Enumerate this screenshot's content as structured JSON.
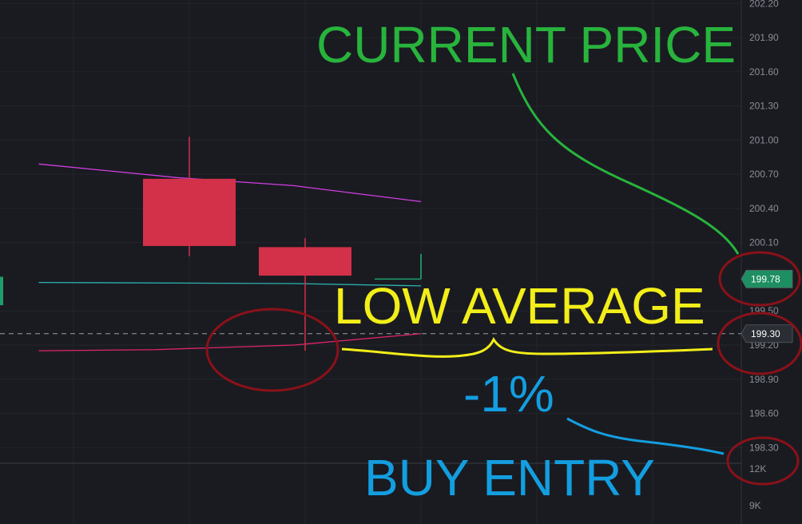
{
  "chart_data": {
    "type": "candlestick",
    "y_axis": {
      "range": [
        198.12,
        202.23
      ],
      "ticks": [
        "202.20",
        "201.90",
        "201.60",
        "201.30",
        "201.00",
        "200.70",
        "200.40",
        "200.10",
        "199.50",
        "199.20",
        "198.90",
        "198.60",
        "198.30"
      ]
    },
    "volume_axis": {
      "ticks": [
        "12K",
        "9K"
      ]
    },
    "candles": [
      {
        "index": 0,
        "open": 199.55,
        "high": 200.25,
        "low": 199.0,
        "close": 199.8,
        "direction": "up",
        "partial": true
      },
      {
        "index": 1,
        "open": 200.66,
        "high": 201.03,
        "low": 199.98,
        "close": 200.07,
        "direction": "down"
      },
      {
        "index": 2,
        "open": 200.06,
        "high": 200.14,
        "low": 199.15,
        "close": 199.81,
        "direction": "down"
      },
      {
        "index": 3,
        "open": 199.8,
        "high": 200.0,
        "low": 199.78,
        "close": 199.78,
        "direction": "up",
        "current": true
      }
    ],
    "series": [
      {
        "color": "#d23ee0",
        "points": [
          [
            -0.3,
            200.79
          ],
          [
            0.9,
            200.67
          ],
          [
            1.9,
            200.6
          ],
          [
            3.0,
            200.46
          ]
        ]
      },
      {
        "color": "#2ab3b1",
        "points": [
          [
            -0.3,
            199.75
          ],
          [
            1.9,
            199.74
          ],
          [
            3.0,
            199.72
          ]
        ]
      },
      {
        "color": "#e0246e",
        "points": [
          [
            -0.3,
            199.15
          ],
          [
            0.7,
            199.16
          ],
          [
            1.9,
            199.2
          ],
          [
            3.0,
            199.3
          ]
        ]
      }
    ],
    "price_tags": [
      {
        "label": "199.78",
        "value": 199.78,
        "bg": "#1e8f62",
        "fg": "#ffffff"
      },
      {
        "label": "199.30",
        "value": 199.3,
        "bg": "#2a2d33",
        "fg": "#ffffff"
      }
    ],
    "dashed_line_value": 199.3,
    "annotations": {
      "current_price": "CURRENT PRICE",
      "low_average": "LOW AVERAGE",
      "minus_one": "-1%",
      "buy_entry": "BUY ENTRY"
    },
    "colors": {
      "background": "#1a1b21",
      "up": "#1e9e6a",
      "down": "#d3304a",
      "green_annot": "#28b43c",
      "yellow_annot": "#f2ee19",
      "blue_annot": "#139ee0",
      "circle": "#8a1119"
    }
  }
}
